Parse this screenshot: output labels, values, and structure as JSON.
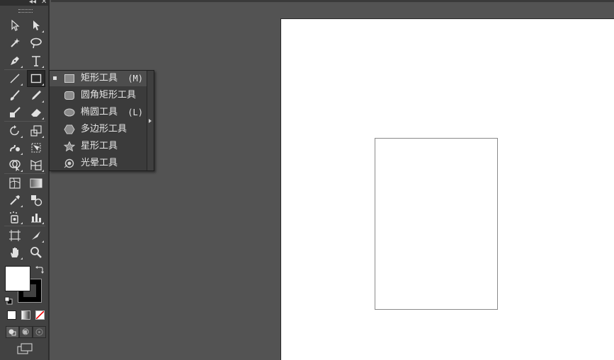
{
  "colors": {
    "workspace": "#535353",
    "toolbar": "#424242",
    "flyout": "#3b3b3b",
    "artboard": "#ffffff"
  },
  "toolbar": {
    "collapse_glyph": "◂◂",
    "close_glyph": "✕",
    "tools": [
      "selection-tool-icon",
      "direct-selection-tool-icon",
      "magic-wand-tool-icon",
      "lasso-tool-icon",
      "pen-tool-icon",
      "type-tool-icon",
      "line-segment-tool-icon",
      "rectangle-tool-icon",
      "paintbrush-tool-icon",
      "pencil-tool-icon",
      "blob-brush-tool-icon",
      "eraser-tool-icon",
      "rotate-tool-icon",
      "scale-tool-icon",
      "warp-tool-icon",
      "free-transform-tool-icon",
      "shape-builder-tool-icon",
      "perspective-grid-tool-icon",
      "mesh-tool-icon",
      "gradient-tool-icon",
      "eyedropper-tool-icon",
      "blend-tool-icon",
      "symbol-sprayer-tool-icon",
      "column-graph-tool-icon",
      "artboard-tool-icon",
      "slice-tool-icon",
      "hand-tool-icon",
      "zoom-tool-icon"
    ]
  },
  "flyout": {
    "items": [
      {
        "label": "矩形工具",
        "shortcut": "(M)",
        "icon": "rectangle-icon",
        "selected": true
      },
      {
        "label": "圆角矩形工具",
        "shortcut": "",
        "icon": "rounded-rectangle-icon",
        "selected": false
      },
      {
        "label": "椭圆工具",
        "shortcut": "(L)",
        "icon": "ellipse-icon",
        "selected": false
      },
      {
        "label": "多边形工具",
        "shortcut": "",
        "icon": "polygon-icon",
        "selected": false
      },
      {
        "label": "星形工具",
        "shortcut": "",
        "icon": "star-icon",
        "selected": false
      },
      {
        "label": "光晕工具",
        "shortcut": "",
        "icon": "flare-icon",
        "selected": false
      }
    ]
  }
}
